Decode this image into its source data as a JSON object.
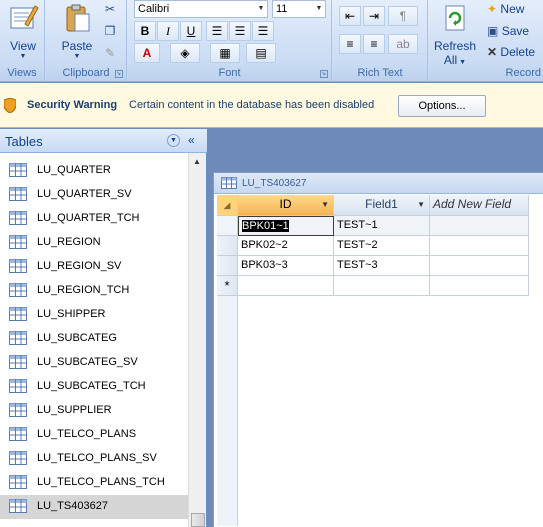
{
  "ribbon": {
    "views": {
      "view_label": "View",
      "group": "Views"
    },
    "clipboard": {
      "paste_label": "Paste",
      "group": "Clipboard"
    },
    "font": {
      "font_name": "Calibri",
      "font_size": "11",
      "bold": "B",
      "italic": "I",
      "underline": "U",
      "group": "Font"
    },
    "rich_text": {
      "group": "Rich Text"
    },
    "records": {
      "refresh_label": "Refresh",
      "refresh_sub": "All",
      "new_label": "New",
      "save_label": "Save",
      "delete_label": "Delete",
      "group": "Record"
    }
  },
  "security": {
    "title": "Security Warning",
    "message": "Certain content in the database has been disabled",
    "options_label": "Options..."
  },
  "nav": {
    "title": "Tables",
    "items": [
      {
        "label": "LU_QUARTER"
      },
      {
        "label": "LU_QUARTER_SV"
      },
      {
        "label": "LU_QUARTER_TCH"
      },
      {
        "label": "LU_REGION"
      },
      {
        "label": "LU_REGION_SV"
      },
      {
        "label": "LU_REGION_TCH"
      },
      {
        "label": "LU_SHIPPER"
      },
      {
        "label": "LU_SUBCATEG"
      },
      {
        "label": "LU_SUBCATEG_SV"
      },
      {
        "label": "LU_SUBCATEG_TCH"
      },
      {
        "label": "LU_SUPPLIER"
      },
      {
        "label": "LU_TELCO_PLANS"
      },
      {
        "label": "LU_TELCO_PLANS_SV"
      },
      {
        "label": "LU_TELCO_PLANS_TCH"
      },
      {
        "label": "LU_TS403627"
      }
    ],
    "selected_index": 14
  },
  "document": {
    "tab_title": "LU_TS403627",
    "columns": [
      "ID",
      "Field1",
      "Add New Field"
    ],
    "rows": [
      [
        "BPK01~1",
        "TEST~1"
      ],
      [
        "BPK02~2",
        "TEST~2"
      ],
      [
        "BPK03~3",
        "TEST~3"
      ]
    ],
    "new_row_marker": "*"
  },
  "colors": {
    "ribbon_bg": "#cfdff5",
    "workspace_bg": "#6d8ab8",
    "selected_header": "#f9b34f",
    "warning_bar": "#fef9e0"
  }
}
